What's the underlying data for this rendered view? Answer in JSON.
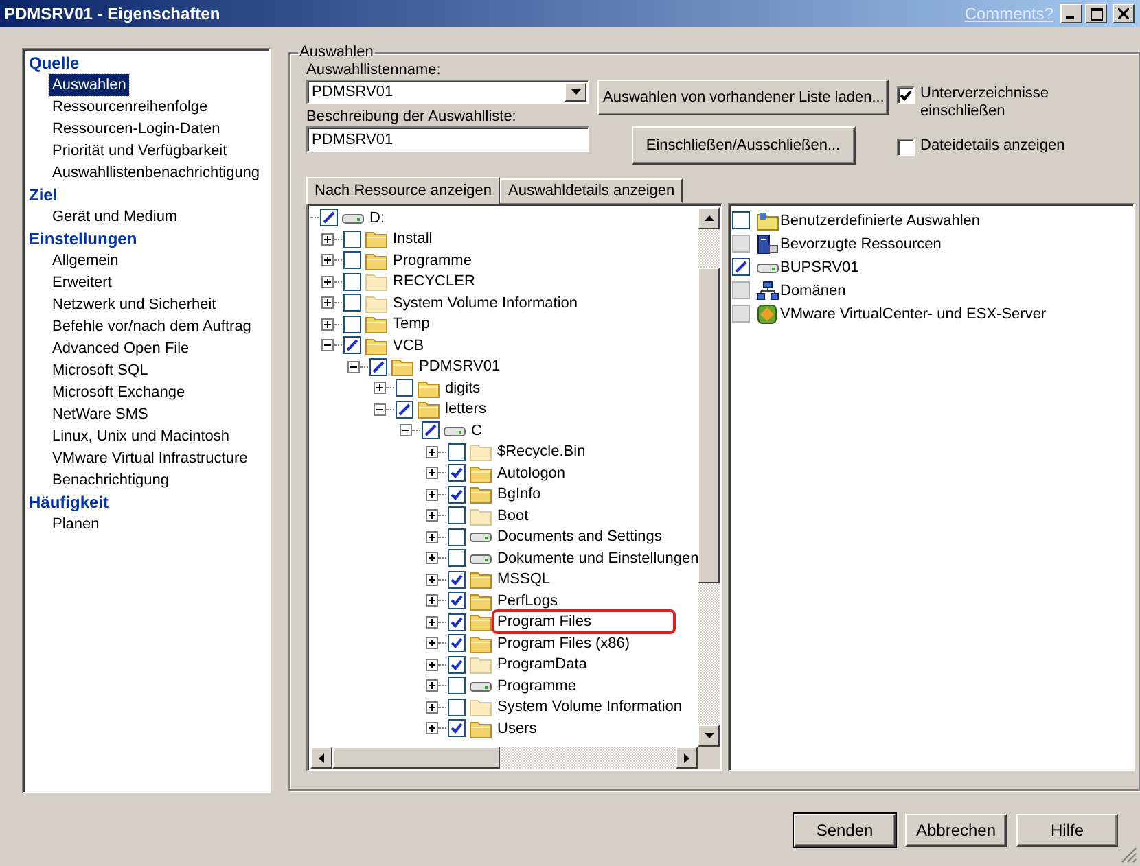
{
  "window": {
    "title": "PDMSRV01 - Eigenschaften",
    "link": "Comments?"
  },
  "sidebar": [
    {
      "heading": "Quelle",
      "items": [
        {
          "label": "Auswahlen",
          "selected": true
        },
        {
          "label": "Ressourcenreihenfolge",
          "selected": false
        },
        {
          "label": "Ressourcen-Login-Daten",
          "selected": false
        },
        {
          "label": "Priorität und Verfügbarkeit",
          "selected": false
        },
        {
          "label": "Auswahllistenbenachrichtigung",
          "selected": false
        }
      ]
    },
    {
      "heading": "Ziel",
      "items": [
        {
          "label": "Gerät und Medium",
          "selected": false
        }
      ]
    },
    {
      "heading": "Einstellungen",
      "items": [
        {
          "label": "Allgemein",
          "selected": false
        },
        {
          "label": "Erweitert",
          "selected": false
        },
        {
          "label": "Netzwerk und Sicherheit",
          "selected": false
        },
        {
          "label": "Befehle vor/nach dem Auftrag",
          "selected": false
        },
        {
          "label": "Advanced Open File",
          "selected": false
        },
        {
          "label": "Microsoft SQL",
          "selected": false
        },
        {
          "label": "Microsoft Exchange",
          "selected": false
        },
        {
          "label": "NetWare SMS",
          "selected": false
        },
        {
          "label": "Linux, Unix und Macintosh",
          "selected": false
        },
        {
          "label": "VMware Virtual Infrastructure",
          "selected": false
        },
        {
          "label": "Benachrichtigung",
          "selected": false
        }
      ]
    },
    {
      "heading": "Häufigkeit",
      "items": [
        {
          "label": "Planen",
          "selected": false
        }
      ]
    }
  ],
  "group": {
    "title": "Auswahlen",
    "name_label": "Auswahllistenname:",
    "name_value": "PDMSRV01",
    "description_label": "Beschreibung der Auswahlliste:",
    "description_value": "PDMSRV01",
    "buttons": [
      "Auswahlen von vorhandener Liste laden...",
      "Einschließen/Ausschließen..."
    ],
    "options": [
      {
        "label": "Unterverzeichnisse einschließen",
        "checked": true
      },
      {
        "label": "Dateidetails anzeigen",
        "checked": false
      }
    ]
  },
  "tabs": [
    {
      "label": "Nach Ressource anzeigen",
      "selected": true
    },
    {
      "label": "Auswahldetails anzeigen",
      "selected": false
    }
  ],
  "tree": [
    {
      "label": "D:",
      "kind": "drive",
      "checked": true,
      "partial": true,
      "children": [
        {
          "label": "Install",
          "kind": "folder",
          "checked": false,
          "expanded": false
        },
        {
          "label": "Programme",
          "kind": "folder",
          "checked": false,
          "expanded": false
        },
        {
          "label": "RECYCLER",
          "kind": "hidden-folder",
          "checked": false,
          "expanded": false
        },
        {
          "label": "System Volume Information",
          "kind": "hidden-folder",
          "checked": false,
          "expanded": false
        },
        {
          "label": "Temp",
          "kind": "folder",
          "checked": false,
          "expanded": false
        },
        {
          "label": "VCB",
          "kind": "folder",
          "checked": true,
          "partial": true,
          "expanded": true,
          "children": [
            {
              "label": "PDMSRV01",
              "kind": "folder",
              "checked": true,
              "partial": true,
              "expanded": true,
              "children": [
                {
                  "label": "digits",
                  "kind": "folder",
                  "checked": false,
                  "expanded": false
                },
                {
                  "label": "letters",
                  "kind": "folder",
                  "checked": true,
                  "partial": true,
                  "expanded": true,
                  "children": [
                    {
                      "label": "C",
                      "kind": "drive",
                      "checked": true,
                      "partial": true,
                      "expanded": true,
                      "children": [
                        {
                          "label": "$Recycle.Bin",
                          "kind": "hidden-folder",
                          "checked": false,
                          "expanded": false,
                          "highlighted": false
                        },
                        {
                          "label": "Autologon",
                          "kind": "folder",
                          "checked": true,
                          "expanded": false,
                          "highlighted": false
                        },
                        {
                          "label": "BgInfo",
                          "kind": "folder",
                          "checked": true,
                          "expanded": false,
                          "highlighted": false
                        },
                        {
                          "label": "Boot",
                          "kind": "hidden-folder",
                          "checked": false,
                          "expanded": false,
                          "highlighted": false
                        },
                        {
                          "label": "Documents and Settings",
                          "kind": "drive",
                          "checked": false,
                          "expanded": false,
                          "highlighted": false
                        },
                        {
                          "label": "Dokumente und Einstellungen",
                          "kind": "drive",
                          "checked": false,
                          "expanded": false,
                          "highlighted": false
                        },
                        {
                          "label": "MSSQL",
                          "kind": "folder",
                          "checked": true,
                          "expanded": false,
                          "highlighted": false
                        },
                        {
                          "label": "PerfLogs",
                          "kind": "folder",
                          "checked": true,
                          "expanded": false,
                          "highlighted": false
                        },
                        {
                          "label": "Program Files",
                          "kind": "folder",
                          "checked": true,
                          "expanded": false,
                          "highlighted": true
                        },
                        {
                          "label": "Program Files (x86)",
                          "kind": "folder",
                          "checked": true,
                          "expanded": false,
                          "highlighted": false
                        },
                        {
                          "label": "ProgramData",
                          "kind": "hidden-folder",
                          "checked": true,
                          "expanded": false,
                          "highlighted": false
                        },
                        {
                          "label": "Programme",
                          "kind": "drive",
                          "checked": false,
                          "expanded": false,
                          "highlighted": false
                        },
                        {
                          "label": "System Volume Information",
                          "kind": "hidden-folder",
                          "checked": false,
                          "expanded": false,
                          "highlighted": false
                        },
                        {
                          "label": "Users",
                          "kind": "folder",
                          "checked": true,
                          "expanded": false,
                          "highlighted": false
                        }
                      ]
                    }
                  ]
                }
              ]
            }
          ]
        }
      ]
    }
  ],
  "resources": [
    {
      "label": "Benutzerdefinierte Auswahlen",
      "kind": "custom",
      "checked": false,
      "disabled": false
    },
    {
      "label": "Bevorzugte Ressourcen",
      "kind": "server",
      "checked": false,
      "disabled": true
    },
    {
      "label": "BUPSRV01",
      "kind": "drive",
      "checked": true,
      "partial": true,
      "disabled": false
    },
    {
      "label": "Domänen",
      "kind": "network",
      "checked": false,
      "disabled": true
    },
    {
      "label": "VMware VirtualCenter- und ESX-Server",
      "kind": "vmware",
      "checked": false,
      "disabled": true
    }
  ],
  "footer_buttons": [
    {
      "label": "Senden",
      "default": true
    },
    {
      "label": "Abbrechen",
      "default": false
    },
    {
      "label": "Hilfe",
      "default": false
    }
  ]
}
